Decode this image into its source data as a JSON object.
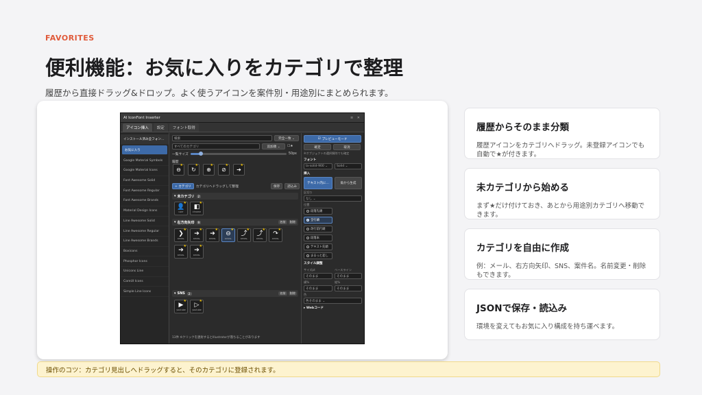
{
  "slide": {
    "eyebrow": "FAVORITES",
    "title": "便利機能：お気に入りをカテゴリで整理",
    "subtitle": "履歴から直接ドラッグ&ドロップ。よく使うアイコンを案件別・用途別にまとめられます。",
    "tip": "操作のコツ：カテゴリ見出しへドラッグすると、そのカテゴリに登録されます。"
  },
  "cards": [
    {
      "title": "履歴からそのまま分類",
      "body": "履歴アイコンをカテゴリへドラッグ。未登録アイコンでも自動で★が付きます。"
    },
    {
      "title": "未カテゴリから始める",
      "body": "まず★だけ付けておき、あとから用途別カテゴリへ移動できます。"
    },
    {
      "title": "カテゴリを自由に作成",
      "body": "例：メール、右方向矢印、SNS、案件名。名前変更・削除もできます。"
    },
    {
      "title": "JSONで保存・読込み",
      "body": "環境を変えてもお気に入り構成を持ち運べます。"
    }
  ],
  "app": {
    "window_title": "AI IconFont Inserter",
    "window_controls": "≡ ✕",
    "tabs": [
      "アイコン挿入",
      "設定",
      "フォント取得"
    ],
    "sidebar": [
      "インストール済み全フォン…",
      "お気に入り",
      "Google Material Symbols",
      "Google Material Icons",
      "Font Awesome Solid",
      "Font Awesome Regular",
      "Font Awesome Brands",
      "Material Design Icons",
      "Line Awesome Solid",
      "Line Awesome Regular",
      "Line Awesome Brands",
      "Boxicons",
      "Phosphor Icons",
      "Unicons Line",
      "CoreUI Icons",
      "Simple Line Icons"
    ],
    "search_placeholder": "検索",
    "match_mode": "完全一致 ⌄",
    "category_filter": "すべてのカテゴリ",
    "sort_order": "追加順 ⌄",
    "size_label": "一覧サイズ",
    "size_value": "50px",
    "history_label": "履歴",
    "add_category": "+ カテゴリ",
    "drag_hint": "カテゴリへドラッグして整理",
    "save_btn": "保存",
    "load_btn": "読込み",
    "rename_btn": "名前",
    "delete_btn": "削除",
    "categories": [
      {
        "name": "未カテゴリ",
        "count": "2",
        "icons": [
          {
            "glyph": "👤",
            "name": "user"
          },
          {
            "glyph": "◧",
            "name": "chrome"
          }
        ]
      },
      {
        "name": "右方向矢印",
        "count": "9",
        "icons": [
          {
            "glyph": "❯",
            "name": "arrow-"
          },
          {
            "glyph": "➔",
            "name": "arrow-"
          },
          {
            "glyph": "➔",
            "name": "arrow-"
          },
          {
            "glyph": "⊖",
            "name": "arrow-"
          },
          {
            "glyph": "⤴",
            "name": "arrow-"
          },
          {
            "glyph": "⤴",
            "name": "arrow-"
          },
          {
            "glyph": "↷",
            "name": "arrow-"
          },
          {
            "glyph": "➔",
            "name": "arrow-"
          },
          {
            "glyph": "➔",
            "name": "arrow-"
          }
        ]
      },
      {
        "name": "SNS",
        "count": "2",
        "icons": [
          {
            "glyph": "▶",
            "name": "youtube"
          },
          {
            "glyph": "▷",
            "name": "youtube"
          }
        ]
      }
    ],
    "status": "13件 ※クリックを連射するとIllustratorが落ちることがあります",
    "right_panel": {
      "preview_mode": "プレビューモード",
      "confirm": "確定",
      "cancel": "取消",
      "preview_note": "※オブジェクトの選択解除でも確定",
      "font_label": "フォント",
      "font_value": "la-solid-900 ⌄",
      "weight_value": "Solid ⌄",
      "insert_label": "挿入",
      "insert_text": "テキスト内に…",
      "insert_new": "角から生成",
      "size_adjust_label": "区切り",
      "size_adjust_value": "なし ⌄",
      "position_label": "位置",
      "positions": [
        "段落先頭",
        "全行頭",
        "改行前行頭",
        "段落末",
        "テキスト先頭",
        "まるっと差し"
      ],
      "style_label": "スタイル調整",
      "size_pt": "サイズpt",
      "baseline": "ベースライン",
      "as_is": "そのまま",
      "tracking": "横%",
      "vertical": "縦%",
      "color_label": "色",
      "color_value": "色そのまま ⌄",
      "webcode": "▸ Webコード"
    }
  }
}
